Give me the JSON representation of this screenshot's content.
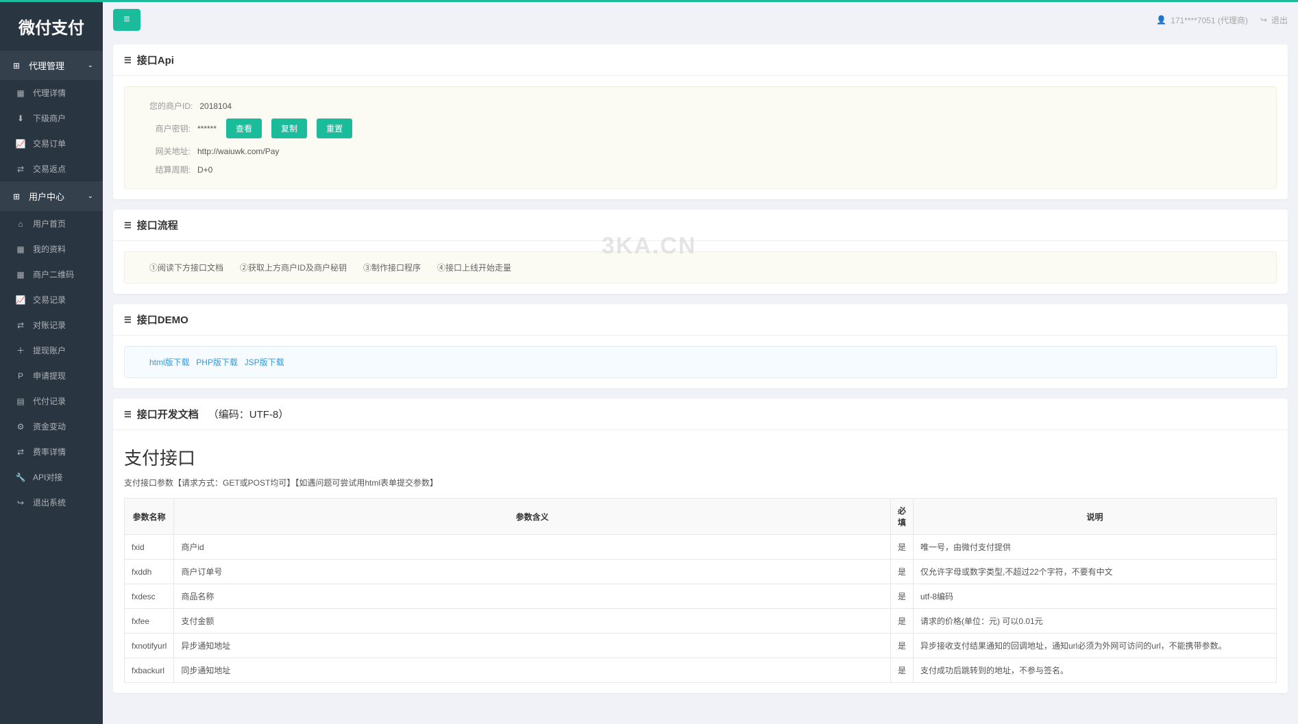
{
  "brand": "微付支付",
  "topbar": {
    "user_label": "171****7051 (代理商)",
    "logout_label": "退出"
  },
  "watermark": "3KA.CN",
  "sidebar": {
    "groups": [
      {
        "title": "代理管理",
        "items": [
          {
            "icon": "▦",
            "label": "代理详情"
          },
          {
            "icon": "⬇",
            "label": "下级商户"
          },
          {
            "icon": "📈",
            "label": "交易订单"
          },
          {
            "icon": "⇄",
            "label": "交易返点"
          }
        ]
      },
      {
        "title": "用户中心",
        "items": [
          {
            "icon": "⌂",
            "label": "用户首页"
          },
          {
            "icon": "▦",
            "label": "我的资料"
          },
          {
            "icon": "▦",
            "label": "商户二维码"
          },
          {
            "icon": "📈",
            "label": "交易记录"
          },
          {
            "icon": "⇄",
            "label": "对账记录"
          },
          {
            "icon": "＋",
            "label": "提现账户"
          },
          {
            "icon": "P",
            "label": "申请提现"
          },
          {
            "icon": "▤",
            "label": "代付记录"
          },
          {
            "icon": "⚙",
            "label": "资金变动"
          },
          {
            "icon": "⇄",
            "label": "费率详情"
          },
          {
            "icon": "🔧",
            "label": "API对接"
          },
          {
            "icon": "↪",
            "label": "退出系统"
          }
        ]
      }
    ]
  },
  "panels": {
    "api": {
      "title": "接口Api",
      "rows": [
        {
          "label": "您的商户ID:",
          "value": "2018104"
        },
        {
          "label": "商户密钥:",
          "value": "******"
        },
        {
          "label": "网关地址:",
          "value": "http://waiuwk.com/Pay"
        },
        {
          "label": "结算周期:",
          "value": "D+0"
        }
      ],
      "buttons": {
        "view": "查看",
        "copy": "复制",
        "reset": "重置"
      }
    },
    "flow": {
      "title": "接口流程",
      "text": "①阅读下方接口文档　　②获取上方商户ID及商户秘钥　　③制作接口程序　　④接口上线开始走量"
    },
    "demo": {
      "title": "接口DEMO",
      "links": [
        "html版下载",
        "PHP版下载",
        "JSP版下载"
      ]
    },
    "doc": {
      "title": "接口开发文档",
      "extra": "（编码：UTF-8）",
      "section_title": "支付接口",
      "section_sub": "支付接口参数【请求方式：GET或POST均可】【如遇问题可尝试用html表单提交参数】",
      "headers": [
        "参数名称",
        "参数含义",
        "必填",
        "说明"
      ],
      "rows": [
        [
          "fxid",
          "商户id",
          "是",
          "唯一号，由微付支付提供"
        ],
        [
          "fxddh",
          "商户订单号",
          "是",
          "仅允许字母或数字类型,不超过22个字符，不要有中文"
        ],
        [
          "fxdesc",
          "商品名称",
          "是",
          "utf-8编码"
        ],
        [
          "fxfee",
          "支付金额",
          "是",
          "请求的价格(单位：元) 可以0.01元"
        ],
        [
          "fxnotifyurl",
          "异步通知地址",
          "是",
          "异步接收支付结果通知的回调地址，通知url必须为外网可访问的url，不能携带参数。"
        ],
        [
          "fxbackurl",
          "同步通知地址",
          "是",
          "支付成功后跳转到的地址，不参与签名。"
        ]
      ]
    }
  }
}
